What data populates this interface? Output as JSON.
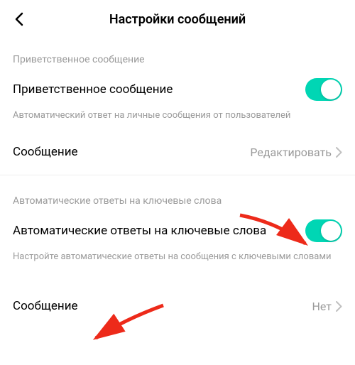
{
  "header": {
    "title": "Настройки сообщений"
  },
  "section1": {
    "label": "Приветственное сообщение",
    "toggle_label": "Приветственное сообщение",
    "description": "Автоматический ответ на личные сообщения от пользователей",
    "message_label": "Сообщение",
    "message_action": "Редактировать"
  },
  "section2": {
    "label": "Автоматические ответы на ключевые слова",
    "toggle_label": "Автоматические ответы на ключевые слова",
    "description": "Настройте автоматические ответы на сообщения с ключевыми словами",
    "message_label": "Сообщение",
    "message_value": "Нет"
  },
  "colors": {
    "accent": "#00d6b4",
    "arrow": "#ed2a1a"
  }
}
